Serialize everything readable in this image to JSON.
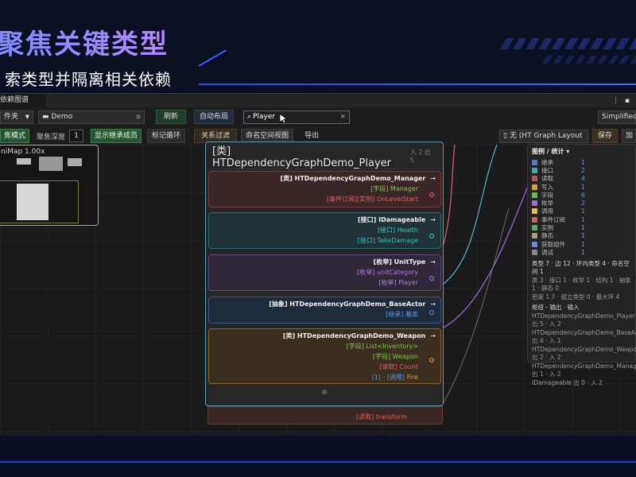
{
  "slide": {
    "title": "聚焦关键类型",
    "subtitle": "索类型并隔离相关依赖"
  },
  "window": {
    "tab": "依赖图谱",
    "menu": "⋮ ▪"
  },
  "toolbar1": {
    "folder_dropdown": "件夹",
    "path_value": "Demo",
    "refresh": "刷新",
    "auto_layout": "自动布局",
    "search_value": "Player",
    "right_dropdown": "Simplified"
  },
  "toolbar2": {
    "focus_mode": "焦模式",
    "focus_depth_label": "聚焦深度",
    "focus_depth_value": "1",
    "show_inherit": "显示继承成员",
    "mark_cycles": "标记循环",
    "relation_filter": "关系过滤",
    "namespace_view": "命名空间视图",
    "export": "导出",
    "layout_dropdown": "无 (HT Graph Layout Pre",
    "save": "保存",
    "load": "加载"
  },
  "minimap": {
    "title": "niMap  1.00x"
  },
  "panel": {
    "title": "[类] HTDependencyGraphDemo_Player",
    "meta": "入 2  出 5",
    "cards": [
      {
        "header": "[类] HTDependencyGraphDemo_Manager",
        "rows": [
          {
            "kind": "[字段]",
            "text": " Manager"
          },
          {
            "kind": "[事件订阅][实例]",
            "text": " OnLevelStart"
          }
        ]
      },
      {
        "header": "[接口] IDamageable",
        "rows": [
          {
            "kind": "[接口]",
            "text": " Health"
          },
          {
            "kind": "[接口]",
            "text": " TakeDamage"
          }
        ]
      },
      {
        "header": "[枚举] UnitType",
        "rows": [
          {
            "kind": "[枚举]",
            "text": " unitCategory"
          },
          {
            "kind": "[枚举]",
            "text": " Player"
          }
        ]
      },
      {
        "header": "[抽象] HTDependencyGraphDemo_BaseActor",
        "rows": [
          {
            "kind": "[继承]",
            "text": " 基类"
          }
        ]
      },
      {
        "header": "[类] HTDependencyGraphDemo_Weapon",
        "rows": [
          {
            "kind": "[字段]",
            "text": " List<Inventory>"
          },
          {
            "kind": "[字段]",
            "text": " Weapon"
          },
          {
            "kind": "[读取]",
            "text": " Count"
          },
          {
            "kind": "(1) - [调用]",
            "text": " Fire"
          }
        ]
      }
    ],
    "footer_icon": "⊕",
    "below_text": "[读取] transform",
    "arrow": "→"
  },
  "legend": {
    "title": "图例 / 统计 ▾",
    "items": [
      {
        "name": "继承",
        "value": "1",
        "color": "#4a7fd4"
      },
      {
        "name": "接口",
        "value": "2",
        "color": "#2fb4b4"
      },
      {
        "name": "读取",
        "value": "4",
        "color": "#c94f4f"
      },
      {
        "name": "写入",
        "value": "1",
        "color": "#d4a13a"
      },
      {
        "name": "字段",
        "value": "6",
        "color": "#6fb84a"
      },
      {
        "name": "枚举",
        "value": "2",
        "color": "#9a6fd4"
      },
      {
        "name": "调用",
        "value": "1",
        "color": "#e0c040"
      },
      {
        "name": "事件订阅",
        "value": "1",
        "color": "#d45a5a"
      },
      {
        "name": "实例",
        "value": "1",
        "color": "#56b05a"
      },
      {
        "name": "静态",
        "value": "1",
        "color": "#b0a070"
      },
      {
        "name": "获取组件",
        "value": "1",
        "color": "#6a8ad4"
      },
      {
        "name": "调试",
        "value": "1",
        "color": "#8a8a8a"
      }
    ],
    "stats1": "类型 7 · 边 12 · 环内类型 4 · 命名空间 1",
    "stats2": "类 3 · 接口 1 · 枚举 1 · 结构 1 · 抽象 1 · 静态 0",
    "stats3": "密度 1.7 · 孤立类型 0 · 最大环 4",
    "hub_title": "枢纽 - 输出 · 输入",
    "hubs": [
      "HTDependencyGraphDemo_Player  出 5 · 入 2",
      "HTDependencyGraphDemo_BaseActor  出 4 · 入 1",
      "HTDependencyGraphDemo_Weapon  出 2 · 入 2",
      "HTDependencyGraphDemo_Manager  出 1 · 入 2",
      "IDamageable  出 0 · 入 2"
    ]
  }
}
